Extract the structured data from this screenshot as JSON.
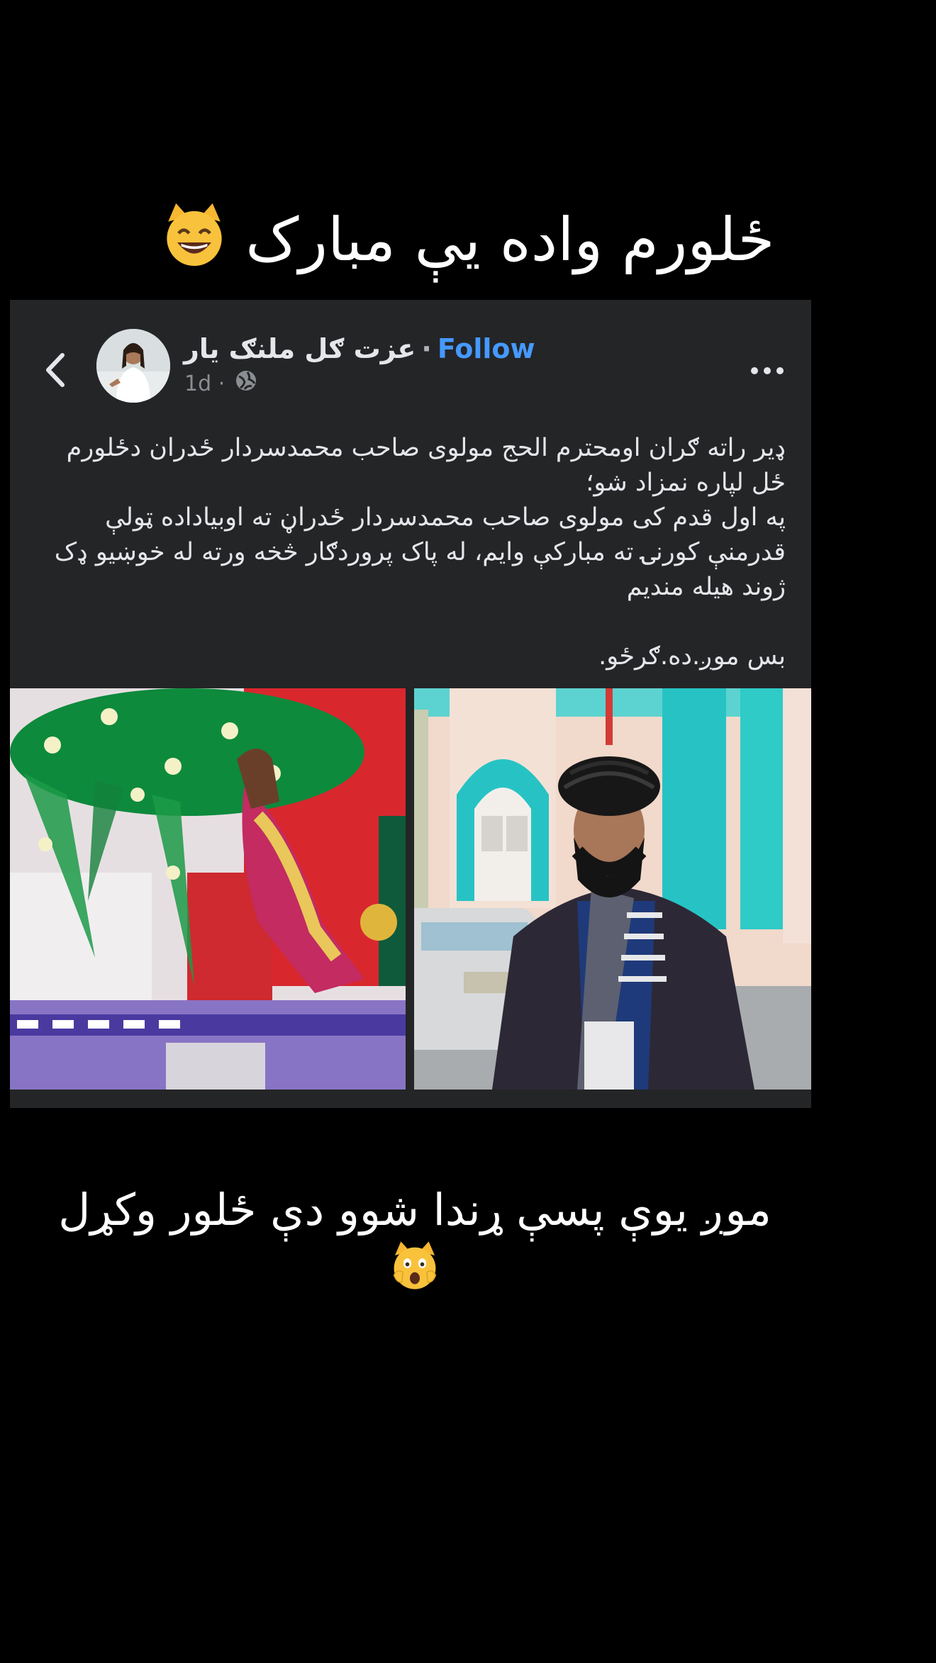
{
  "top_caption": {
    "text": "ځلورم واده یې مبارک",
    "emoji": "😸"
  },
  "post": {
    "author_name": "عزت ګل ملنګ یار",
    "separator": "·",
    "follow_label": "Follow",
    "timestamp": "1d",
    "meta_separator": "·",
    "privacy_icon": "globe-icon",
    "more_icon": "more-horizontal-icon",
    "back_icon": "chevron-left-icon",
    "body_lines": [
      "ډیر راته ګران اومحترم  الحج مولوی صاحب محمدسردار ځدران  دځلورم",
      "ځل لپاره نمزاد شو؛",
      "په اول قدم کی مولوی صاحب محمدسردار ځدراڼ ته اوبیاداده ټولې",
      "قدرمنې کورنۍ ته مبارکې وایم، له پاک پروردګار څخه ورته له خوښیو ډک",
      "ژوند هیله مندیم",
      "",
      "بس موږ.ده.ګرځو."
    ],
    "photos": [
      {
        "name": "bride-veil-photo",
        "description_icon": "photo"
      },
      {
        "name": "man-turban-photo",
        "description_icon": "photo"
      }
    ]
  },
  "bottom_caption": {
    "text": "موږ یوې پسې ړندا شوو دې ځلور وکړل",
    "emoji": "🙀"
  },
  "colors": {
    "background": "#000000",
    "card": "#242526",
    "text_primary": "#e4e6eb",
    "text_secondary": "#8a8d91",
    "follow": "#4599ff"
  }
}
